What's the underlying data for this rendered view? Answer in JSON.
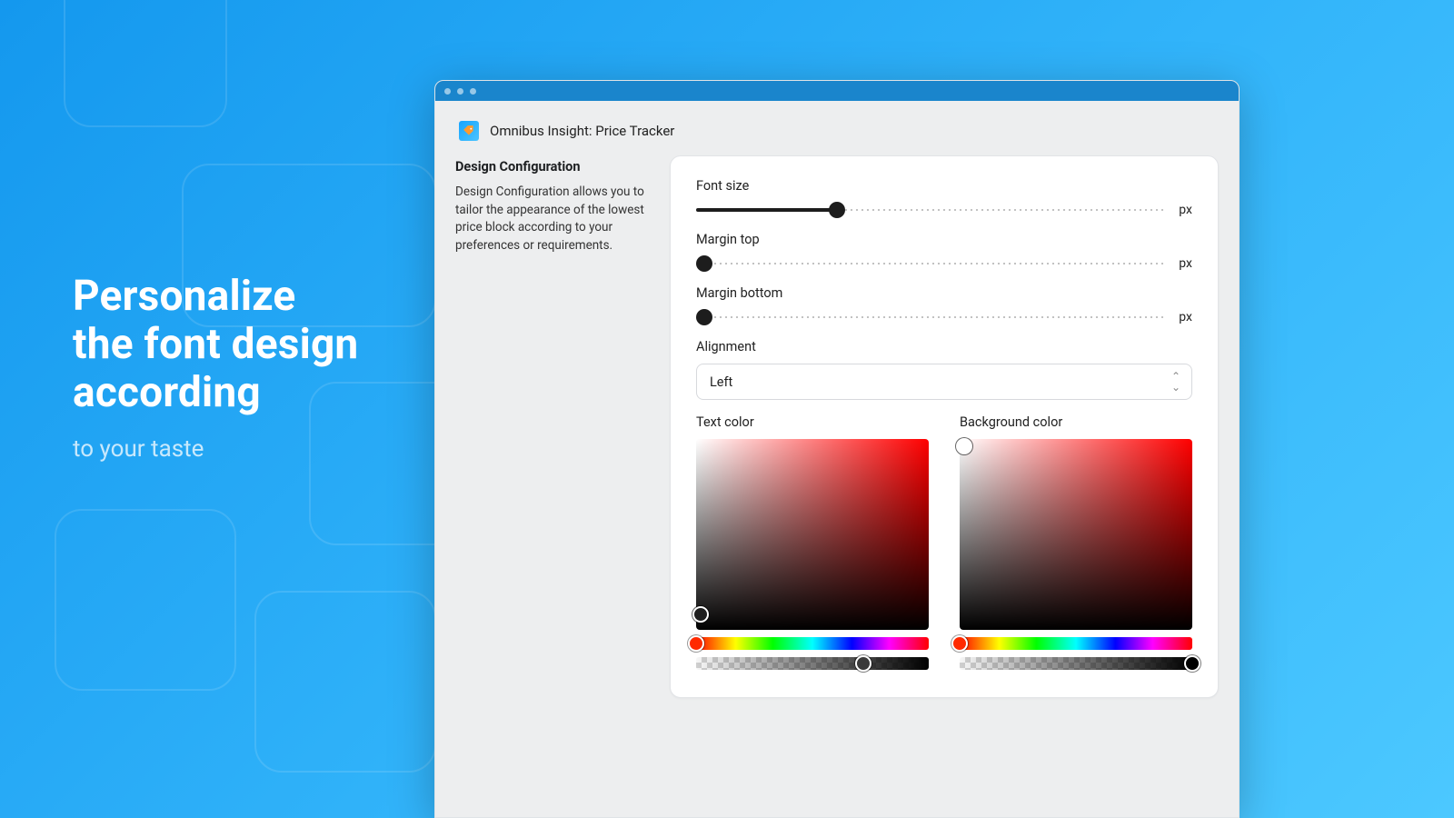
{
  "hero": {
    "line1": "Personalize",
    "line2": "the font design",
    "line3": "according",
    "sub": "to your taste"
  },
  "app": {
    "title": "Omnibus Insight: Price Tracker",
    "icon_name": "price-tag-icon"
  },
  "sidebar": {
    "heading": "Design Configuration",
    "description": "Design Configuration allows you to tailor the appearance of the lowest price block according to your preferences or requirements."
  },
  "form": {
    "font_size": {
      "label": "Font size",
      "unit": "px",
      "fill_pct": 30
    },
    "margin_top": {
      "label": "Margin top",
      "unit": "px",
      "fill_pct": 0
    },
    "margin_bottom": {
      "label": "Margin bottom",
      "unit": "px",
      "fill_pct": 0
    },
    "alignment": {
      "label": "Alignment",
      "selected": "Left"
    },
    "text_color": {
      "label": "Text color",
      "hue": "#ff0000",
      "sat_x_pct": 2,
      "sat_y_pct": 92,
      "hue_thumb_pct": 0,
      "alpha_thumb_pct": 72,
      "sat_thumb_bg": "#1e1e1e",
      "hue_thumb_bg": "#ff2a00",
      "alpha_thumb_bg": "#3a3a3a"
    },
    "bg_color": {
      "label": "Background color",
      "hue": "#ff0000",
      "sat_x_pct": 2,
      "sat_y_pct": 4,
      "hue_thumb_pct": 0,
      "alpha_thumb_pct": 100,
      "sat_thumb_bg": "#ffffff",
      "hue_thumb_bg": "#ff2a00",
      "alpha_thumb_bg": "#000000"
    }
  }
}
